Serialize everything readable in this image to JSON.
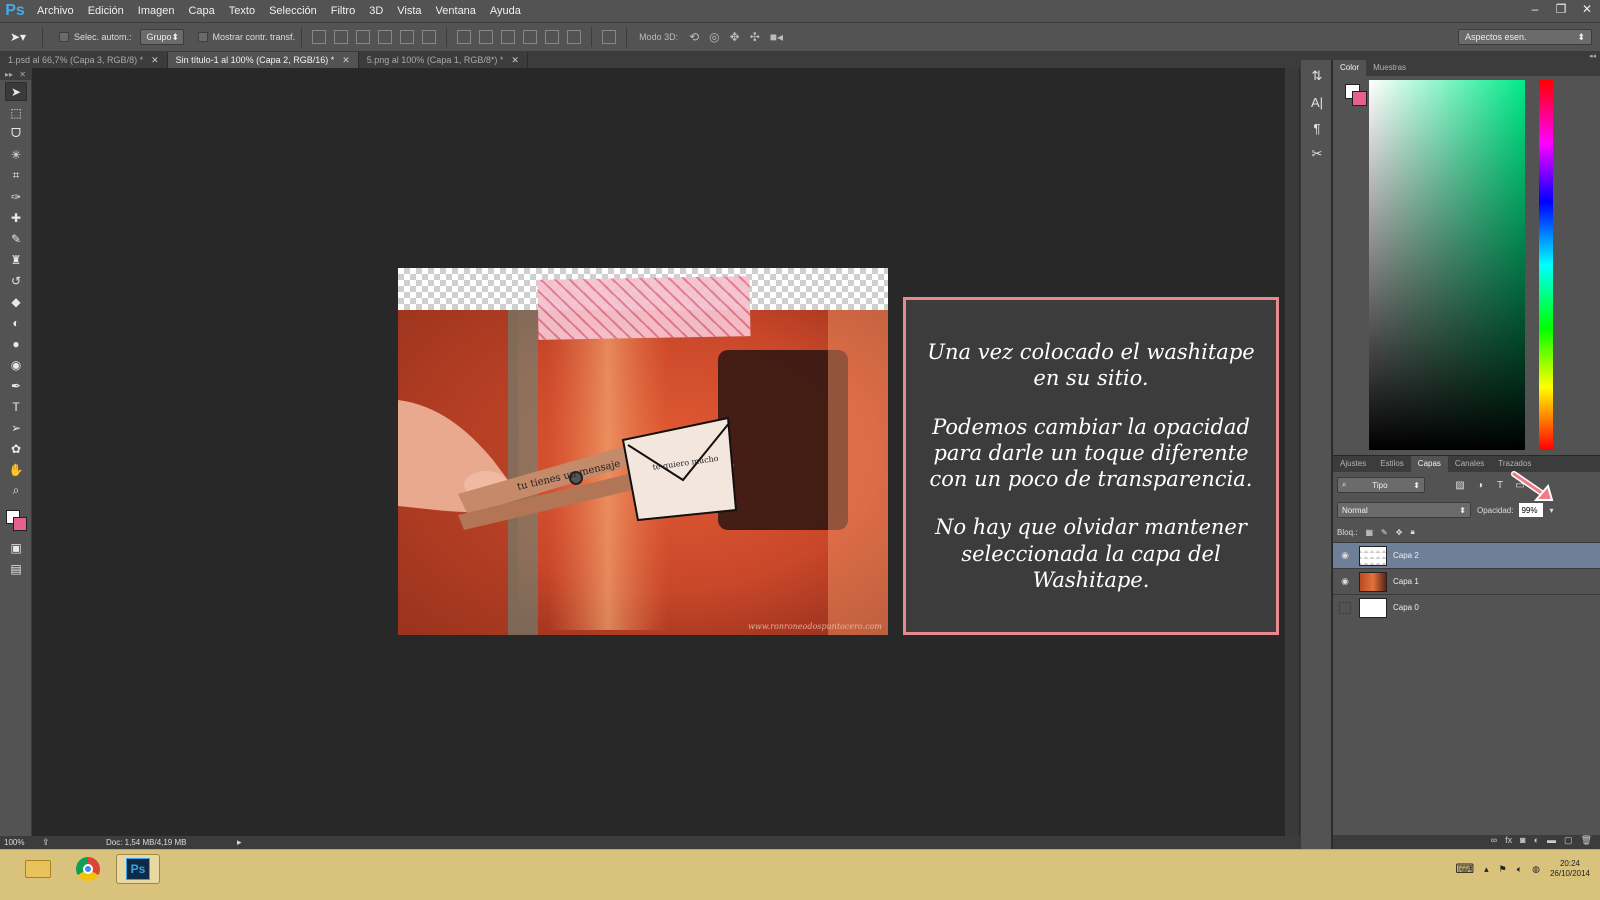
{
  "app": {
    "logo": "Ps"
  },
  "menu": [
    "Archivo",
    "Edición",
    "Imagen",
    "Capa",
    "Texto",
    "Selección",
    "Filtro",
    "3D",
    "Vista",
    "Ventana",
    "Ayuda"
  ],
  "window_controls": [
    "–",
    "❐",
    "✕"
  ],
  "options": {
    "auto_select_label": "Selec. autom.:",
    "auto_select_value": "Grupo",
    "show_transform_label": "Mostrar contr. transf.",
    "mode3d_label": "Modo 3D:",
    "workspace": "Aspectos esen."
  },
  "tabs": [
    {
      "label": "1.psd al 66,7% (Capa 3, RGB/8) *",
      "active": false
    },
    {
      "label": "Sin título-1 al 100% (Capa 2, RGB/16) *",
      "active": true
    },
    {
      "label": "5.png al 100% (Capa 1, RGB/8*) *",
      "active": false
    }
  ],
  "note": {
    "p1": "Una vez colocado el washitape en su sitio.",
    "p2": "Podemos cambiar la opacidad para darle un toque diferente con un poco de transparencia.",
    "p3": "No hay que olvidar mantener seleccionada la capa del Washitape."
  },
  "photo": {
    "credit": "www.ronroneodospuntocero.com",
    "clip_text_1": "tu tienes un mensaje",
    "clip_text_2": "te quiero mucho"
  },
  "status": {
    "zoom": "100%",
    "doc": "Doc: 1,54 MB/4,19 MB"
  },
  "color_panel": {
    "tabs": [
      "Color",
      "Muestras"
    ],
    "fg": "#ffffff",
    "bg": "#e7628a"
  },
  "layers_panel": {
    "tabs": [
      "Ajustes",
      "Estilos",
      "Capas",
      "Canales",
      "Trazados"
    ],
    "active_tab": "Capas",
    "filter": "Tipo",
    "blend_mode": "Normal",
    "opacity_label": "Opacidad:",
    "opacity_value": "99%",
    "lock_label": "Bloq.:",
    "layers": [
      {
        "name": "Capa 2",
        "visible": true,
        "selected": true
      },
      {
        "name": "Capa 1",
        "visible": true,
        "selected": false
      },
      {
        "name": "Capa 0",
        "visible": false,
        "selected": false
      }
    ],
    "footer_icons": [
      "link-icon",
      "fx-icon",
      "mask-icon",
      "adjustment-icon",
      "folder-icon",
      "new-layer-icon",
      "trash-icon"
    ]
  },
  "taskbar": {
    "time": "20:24",
    "date": "26/10/2014",
    "ps_label": "Ps"
  },
  "colors": {
    "accent": "#e68a8f",
    "selection": "#6f7f98",
    "taskbar": "#d8c27c"
  }
}
